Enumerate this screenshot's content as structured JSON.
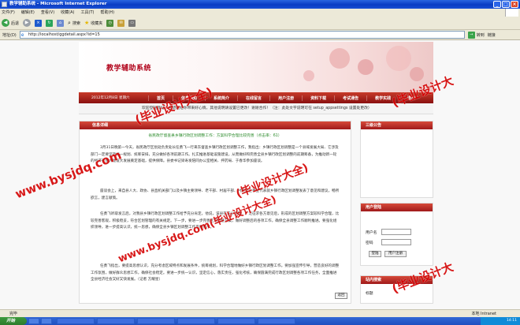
{
  "window": {
    "title": "教学辅助系统 - Microsoft Internet Explorer",
    "min": "_",
    "max": "□",
    "close": "×"
  },
  "menu": [
    "文件(F)",
    "编辑(E)",
    "查看(V)",
    "收藏(A)",
    "工具(T)",
    "帮助(H)"
  ],
  "toolbar": {
    "back": "后退",
    "forward": "",
    "search": "搜索",
    "favorites": "收藏夹"
  },
  "address": {
    "label": "地址(D)",
    "url": "http://localhost/ggdetail.aspx?id=15",
    "go": "转到",
    "links": "链接"
  },
  "site": {
    "title": "教学辅助系统",
    "date": "2012年12月8日 星期六",
    "nav": [
      "首页",
      "信息通知",
      "系统简介",
      "在线留言",
      "用户注册",
      "资料下载",
      "考试通告",
      "教学实践",
      "退出"
    ],
    "marquee": "欢迎登陆我站，希望能给你带来好心情，其他说明请设置已更改！谢谢合作！（注：此处文字说明可在 setup_appsettings 设置处更改）"
  },
  "left": {
    "section": "信息详细",
    "article_title": "省民政厅督查县乡镇行政区划调整工作：方案科学合理比较完善（点击率：61）",
    "paras": [
      "3月31日晚第一今天，省民政厅区划处负责处长任勇飞一行来东督查乡镇行政区划调整工作，我指出：乡镇行政区划调整是一个县域发展大局、它涉及部门一定要坚持统一规划、统筹安排，充分做好各项前期工作。扎实推进基础设施建设，从而做好和完善全县乡镇行政区划调整的前期筹备，为推动新一轮的经济社会大建设大发展奠定基础，提供保障。县委书记梁寿发陪同办公室相关、抨药局、于春华参加座谈。",
      "座谈会上，来自县人大、政协、县直机关部门以及乡镇主要领导、老干部、村居干部、村民和企事业代表就乡镇行政区划调整发表了意见和建议，畅所欲言，建言献策。",
      "任勇飞听取发言后，对我县乡镇行政区划调整工作给予充分肯定。他说，该县在充分调研、广泛征求各方意见后，形成的区划调整方案较科学合理，比较完善客观，积极稳妥，符合区划管理的有关规定。下一步，要进一步完善区划调整方案，做好调整后的各项工作，确保全县调整工作顺利推进。要强化组织领导，进一步提高认识，统一思想，确保全县乡镇区划调整工作平稳有序。",
      "任勇飞指出，要提高思想认识，充分考虑区域特点和发展条件，统筹规划，科学合理地做好乡镇行政区划调整工作。要加强宣传引导，营造良好的调整工作氛围，做好群众思想工作，确保社会稳定。要进一步统一认识，坚定信心，落实责任，强化考核，确保圆满完成行政区划调整各项工作任务，全面推进全县经济社会又好又快发展。（记者 方耀星）"
    ],
    "back": "返回"
  },
  "right": {
    "notice_title": "三级公告",
    "login_title": "用户登陆",
    "login": {
      "user_label": "用户名",
      "pass_label": "密码",
      "login_btn": "登陆",
      "register_btn": "用户注册"
    },
    "search_title": "站内搜索",
    "search_label": "标题"
  },
  "status": {
    "left": "完毕",
    "zone": "本地 Intranet"
  },
  "taskbar": {
    "start": "开始",
    "clock": "14:11"
  },
  "watermarks": {
    "domain": "www.bysjdq.com",
    "brand": "(毕业设计大全)",
    "domain_mid": "www.bysjdq.com(毕业设计大全)",
    "right_top": "(毕业设计大",
    "right_bottom": "(毕业设计大"
  }
}
